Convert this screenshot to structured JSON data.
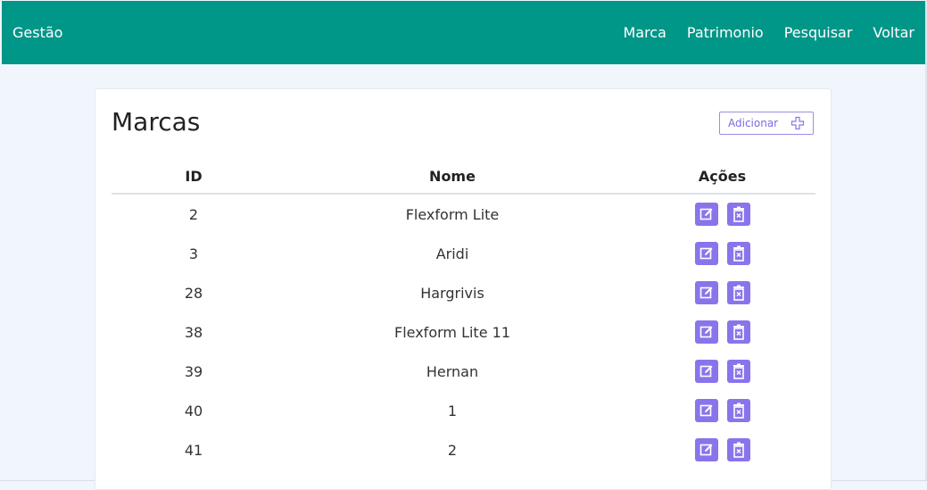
{
  "navbar": {
    "brand": "Gestão",
    "links": [
      "Marca",
      "Patrimonio",
      "Pesquisar",
      "Voltar"
    ]
  },
  "page": {
    "title": "Marcas",
    "add_button": "Adicionar"
  },
  "table": {
    "headers": [
      "ID",
      "Nome",
      "Ações"
    ],
    "rows": [
      {
        "id": "2",
        "nome": "Flexform Lite"
      },
      {
        "id": "3",
        "nome": "Aridi"
      },
      {
        "id": "28",
        "nome": "Hargrivis"
      },
      {
        "id": "38",
        "nome": "Flexform Lite 11"
      },
      {
        "id": "39",
        "nome": "Hernan"
      },
      {
        "id": "40",
        "nome": "1"
      },
      {
        "id": "41",
        "nome": "2"
      }
    ]
  },
  "icons": {
    "add": "plus-outline-icon",
    "edit": "edit-icon",
    "delete": "trash-icon"
  },
  "colors": {
    "navbar": "#009688",
    "accent": "#8a74ec",
    "background": "#f1f6fd"
  }
}
